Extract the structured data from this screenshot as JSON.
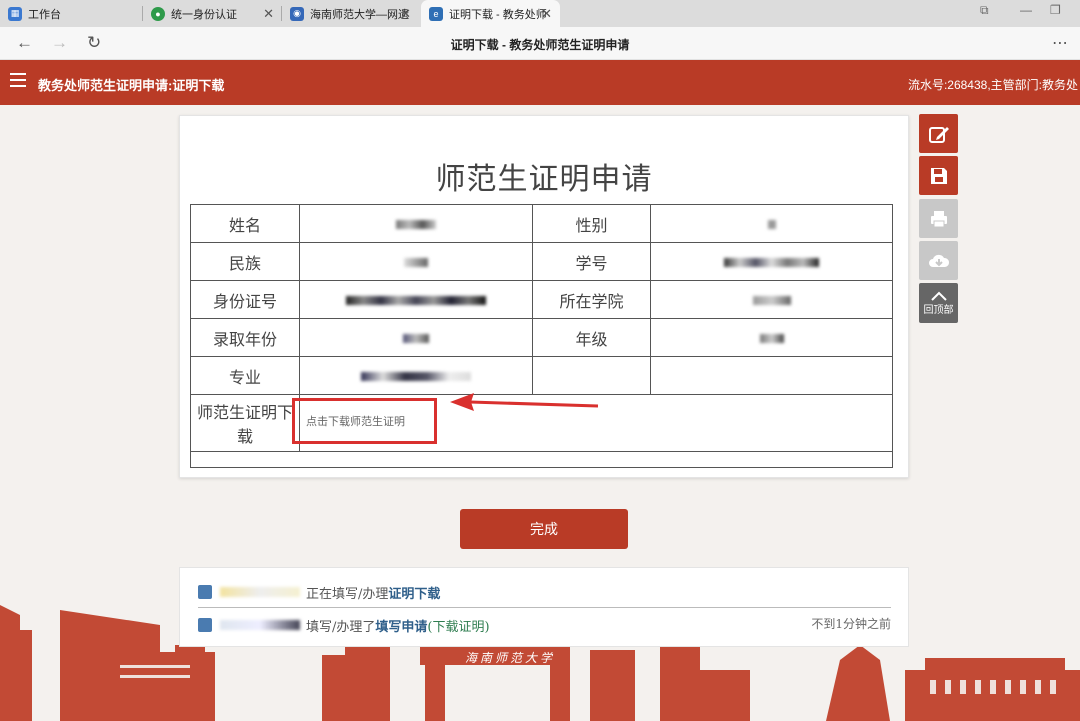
{
  "browser": {
    "tabs": [
      {
        "title": "工作台"
      },
      {
        "title": "统一身份认证"
      },
      {
        "title": "海南师范大学—网遗"
      },
      {
        "title": "证明下载 - 教务处师"
      }
    ],
    "page_title": "证明下载 - 教务处师范生证明申请"
  },
  "header": {
    "title": "教务处师范生证明申请:证明下载",
    "serial": "流水号:268438,主管部门:教务处"
  },
  "form": {
    "title": "师范生证明申请",
    "labels": {
      "name": "姓名",
      "gender": "性别",
      "ethnicity": "民族",
      "student_id": "学号",
      "id_number": "身份证号",
      "college": "所在学院",
      "admission_year": "录取年份",
      "grade": "年级",
      "major": "专业",
      "download": "师范生证明下载"
    },
    "download_link": "点击下载师范生证明"
  },
  "side_tools": {
    "back_to_top": "回顶部"
  },
  "done_button": "完成",
  "log": {
    "row1": {
      "prefix": "正在填写/办理",
      "action": "证明下载"
    },
    "row2": {
      "prefix": "填写/办理了",
      "action": "填写申请",
      "link": "(下载证明)",
      "time": "不到1分钟之前"
    }
  },
  "colors": {
    "brand_red": "#b93b26",
    "highlight_red": "#d9302e"
  }
}
